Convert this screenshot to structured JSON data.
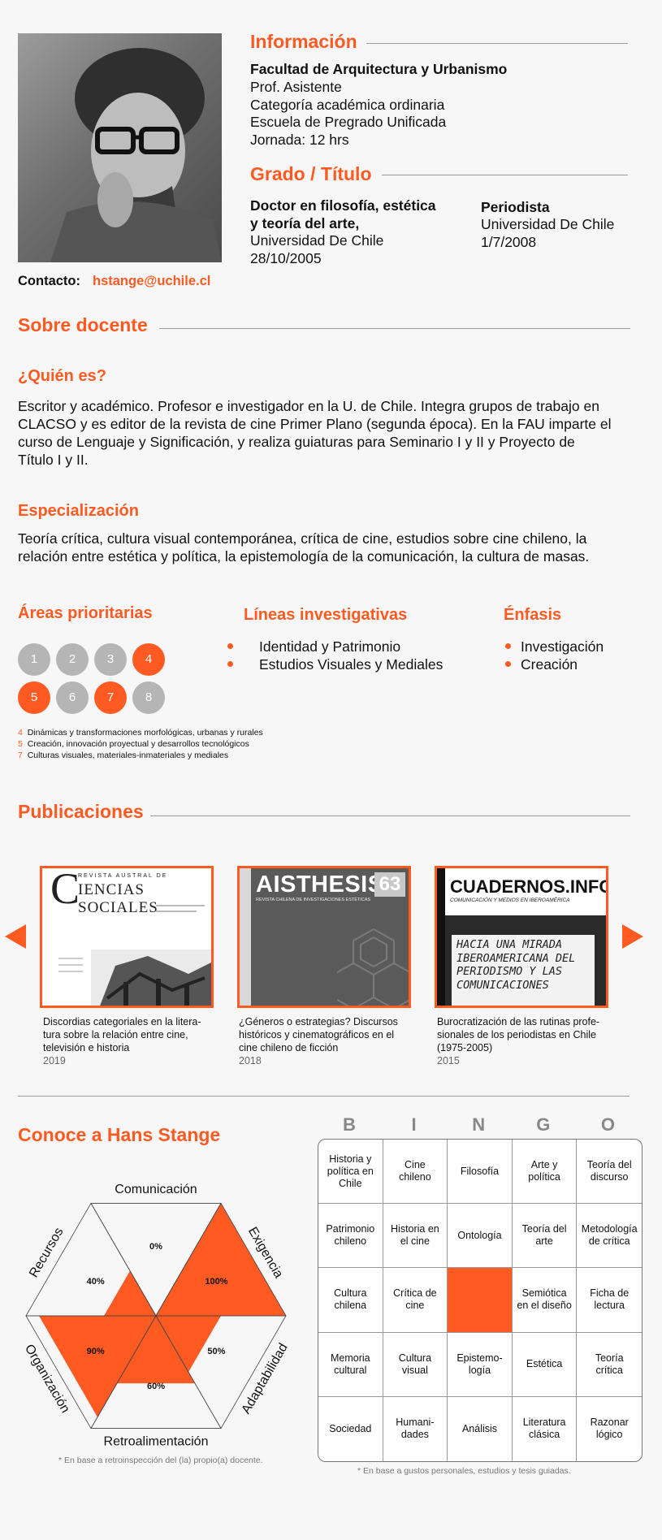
{
  "info": {
    "heading": "Información",
    "faculty": "Facultad de Arquitectura y Urbanismo",
    "lines": [
      "Prof. Asistente",
      "Categoría académica ordinaria",
      "Escuela de Pregrado Unificada",
      "Jornada: 12 hrs"
    ]
  },
  "degree": {
    "heading": "Grado / Título",
    "d1_title_1": "Doctor en filosofía, estética",
    "d1_title_2": "y teoría del arte,",
    "d1_univ": "Universidad De Chile",
    "d1_date": "28/10/2005",
    "d2_title": "Periodista",
    "d2_univ": "Universidad De Chile",
    "d2_date": "1/7/2008"
  },
  "contact": {
    "label": "Contacto:",
    "email": "hstange@uchile.cl"
  },
  "about": {
    "heading": "Sobre docente",
    "who_heading": "¿Quién es?",
    "who_lines": [
      "Escritor y académico. Profesor e investigador en la U. de Chile. Integra grupos de trabajo en",
      "CLACSO y es editor de la revista de cine Primer Plano (segunda época). En la FAU imparte el",
      "curso de Lenguaje y Significación, y realiza guiaturas para Seminario I y II y Proyecto de",
      "Título I y II."
    ],
    "spec_heading": "Especialización",
    "spec_lines": [
      "Teoría crítica, cultura visual contemporánea, crítica de cine, estudios sobre cine chileno, la",
      "relación entre estética y política, la epistemología de la comunicación, la cultura de masas."
    ]
  },
  "areas": {
    "heading": "Áreas prioritarias",
    "numbers": [
      "1",
      "2",
      "3",
      "4",
      "5",
      "6",
      "7",
      "8"
    ],
    "active": [
      "4",
      "5",
      "7"
    ],
    "legend": [
      {
        "num": "4",
        "text": "Dinámicas y transformaciones morfológicas, urbanas y rurales"
      },
      {
        "num": "5",
        "text": "Creación, innovación proyectual y desarrollos tecnológicos"
      },
      {
        "num": "7",
        "text": "Culturas visuales, materiales-inmateriales y mediales"
      }
    ]
  },
  "lines_research": {
    "heading": "Líneas investigativas",
    "items": [
      "Identidad y Patrimonio",
      "Estudios Visuales y Mediales"
    ]
  },
  "emphasis": {
    "heading": "Énfasis",
    "items": [
      "Investigación",
      "Creación"
    ]
  },
  "publications": {
    "heading": "Publicaciones",
    "items": [
      {
        "cover_top": "REVISTA AUSTRAL DE",
        "cover_title": "IENCIAS SOCIALES",
        "cover_big_letter": "C",
        "cap": [
          "Discordias categoriales en la litera-",
          "tura sobre la relación entre cine,",
          "televisión e historia"
        ],
        "year": "2019"
      },
      {
        "cover_title": "AISTHESIS",
        "cover_num": "63",
        "cover_sub": "REVISTA CHILENA DE INVESTIGACIONES ESTÉTICAS",
        "cap": [
          "¿Géneros o estrategias? Discursos",
          "históricos y cinematográficos en el",
          "cine chileno de ficción"
        ],
        "year": "2018"
      },
      {
        "cover_title": "CUADERNOS.INFO",
        "cover_sub": "COMUNICACIÓN Y MEDIOS EN IBEROAMÉRICA",
        "cover_text": [
          "HACIA UNA MIRADA",
          "IBEROAMERICANA DEL",
          "PERIODISMO Y LAS",
          "COMUNICACIONES"
        ],
        "cap": [
          "Burocratización de las rutinas profe-",
          "sionales de los periodistas en Chile",
          "(1975-2005)"
        ],
        "year": "2015"
      }
    ]
  },
  "know": {
    "heading": "Conoce a Hans Stange"
  },
  "radar": {
    "labels": [
      "Comunicación",
      "Exigencia",
      "Adaptabilidad",
      "Retroalimentación",
      "Organización",
      "Recursos"
    ],
    "values": [
      "0%",
      "100%",
      "50%",
      "60%",
      "90%",
      "40%"
    ],
    "fractions": [
      0,
      1.0,
      0.5,
      0.6,
      0.9,
      0.4
    ],
    "color": "#ff5a22",
    "note": "* En base a retroinspección del (la) propio(a) docente."
  },
  "bingo": {
    "letters": [
      "B",
      "I",
      "N",
      "G",
      "O"
    ],
    "cells": [
      [
        "Historia y\npolítica en\nChile",
        "Cine\nchileno",
        "Filosofía",
        "Arte y\npolítica",
        "Teoría del\ndiscurso"
      ],
      [
        "Patrimonio\nchileno",
        "Historia en\nel cine",
        "Ontología",
        "Teoría del\narte",
        "Metodología\nde crítica"
      ],
      [
        "Cultura\nchilena",
        "Crítica de\ncine",
        "",
        "Semiótica\nen el diseño",
        "Ficha de\nlectura"
      ],
      [
        "Memoria\ncultural",
        "Cultura\nvisual",
        "Epistemo-\nlogía",
        "Estética",
        "Teoría\ncrítica"
      ],
      [
        "Sociedad",
        "Humani-\ndades",
        "Análisis",
        "Literatura\nclásica",
        "Razonar\nlógico"
      ]
    ],
    "note": "* En base a gustos personales, estudios y tesis guiadas."
  }
}
